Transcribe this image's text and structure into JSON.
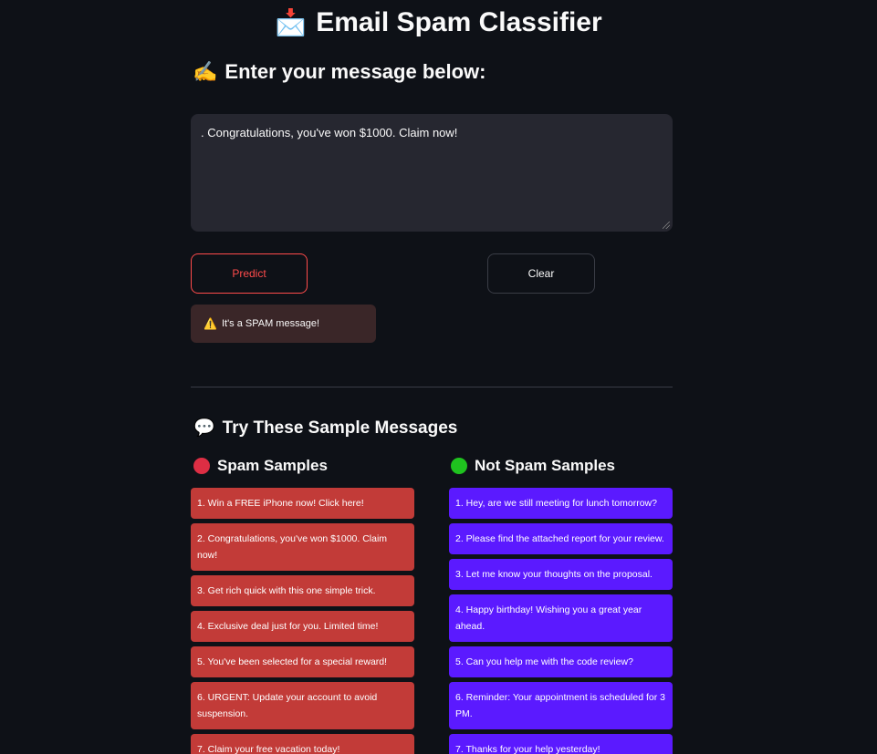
{
  "header": {
    "title_emoji": "📩",
    "title": "Email Spam Classifier"
  },
  "input_section": {
    "emoji": "✍️",
    "label": "Enter your message below:",
    "message_value": ". Congratulations, you've won $1000. Claim now!"
  },
  "actions": {
    "predict_label": "Predict",
    "clear_label": "Clear"
  },
  "result": {
    "icon": "⚠️",
    "text": "It's a SPAM message!"
  },
  "samples_section": {
    "emoji": "💬",
    "title": "Try These Sample Messages",
    "spam": {
      "header": "Spam Samples",
      "items": [
        "1. Win a FREE iPhone now! Click here!",
        "2. Congratulations, you've won $1000. Claim now!",
        "3. Get rich quick with this one simple trick.",
        "4. Exclusive deal just for you. Limited time!",
        "5. You've been selected for a special reward!",
        "6. URGENT: Update your account to avoid suspension.",
        "7. Claim your free vacation today!"
      ]
    },
    "not_spam": {
      "header": "Not Spam Samples",
      "items": [
        "1. Hey, are we still meeting for lunch tomorrow?",
        "2. Please find the attached report for your review.",
        "3. Let me know your thoughts on the proposal.",
        "4. Happy birthday! Wishing you a great year ahead.",
        "5. Can you help me with the code review?",
        "6. Reminder: Your appointment is scheduled for 3 PM.",
        "7. Thanks for your help yesterday!"
      ]
    }
  },
  "colors": {
    "background": "#0e1117",
    "accent": "#ff4b4b",
    "spam_card": "#c23b38",
    "ham_card": "#5b1aff"
  }
}
